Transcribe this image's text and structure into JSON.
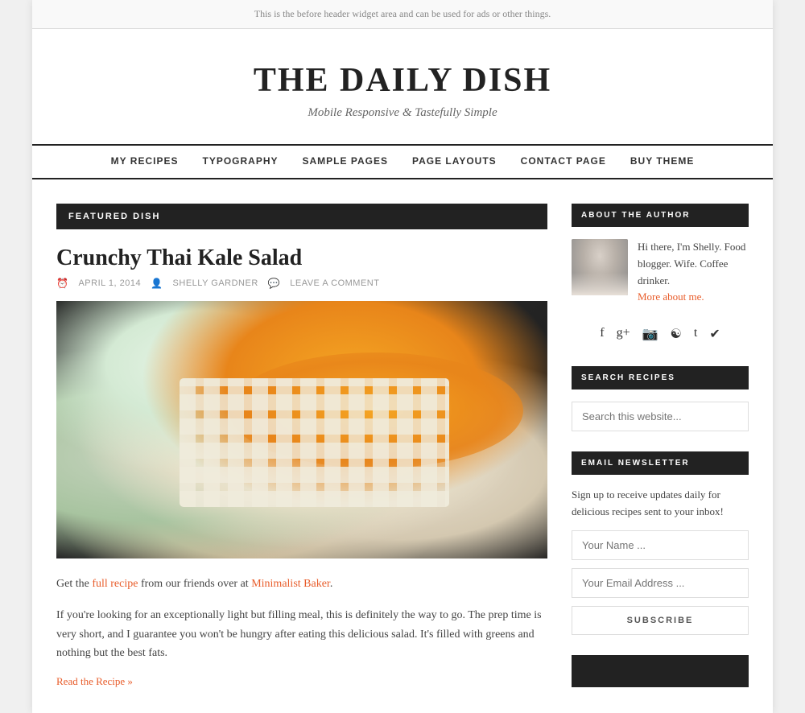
{
  "before_header": {
    "text": "This is the before header widget area and can be used for ads or other things."
  },
  "site": {
    "title": "THE DAILY DISH",
    "tagline": "Mobile Responsive & Tastefully Simple"
  },
  "nav": {
    "items": [
      {
        "label": "MY RECIPES",
        "url": "#"
      },
      {
        "label": "TYPOGRAPHY",
        "url": "#"
      },
      {
        "label": "SAMPLE PAGES",
        "url": "#"
      },
      {
        "label": "PAGE LAYOUTS",
        "url": "#"
      },
      {
        "label": "CONTACT PAGE",
        "url": "#"
      },
      {
        "label": "BUY THEME",
        "url": "#"
      }
    ]
  },
  "featured": {
    "label": "FEATURED DISH"
  },
  "post": {
    "title": "Crunchy Thai Kale Salad",
    "date": "APRIL 1, 2014",
    "author": "SHELLY GARDNER",
    "comment_label": "LEAVE A COMMENT",
    "body1": "Get the ",
    "link1": "full recipe",
    "body1b": " from our friends over at ",
    "link2": "Minimalist Baker",
    "body1c": ".",
    "body2": "If you're looking for an exceptionally light but filling meal, this is definitely the way to go. The prep time is very short, and I guarantee you won't be hungry after eating this delicious salad. It's filled with greens and nothing but the best fats.",
    "read_more": "Read the Recipe »"
  },
  "sidebar": {
    "about_heading": "ABOUT THE AUTHOR",
    "author_bio": "Hi there, I'm Shelly. Food blogger. Wife. Coffee drinker.",
    "author_link": "More about me.",
    "social_icons": [
      "f",
      "g+",
      "cam",
      "pin",
      "t",
      "bird"
    ],
    "search_heading": "SEARCH RECIPES",
    "search_placeholder": "Search this website...",
    "newsletter_heading": "EMAIL NEWSLETTER",
    "newsletter_text": "Sign up to receive updates daily for delicious recipes sent to your inbox!",
    "name_placeholder": "Your Name ...",
    "email_placeholder": "Your Email Address ...",
    "subscribe_label": "SUBSCRIBE"
  }
}
